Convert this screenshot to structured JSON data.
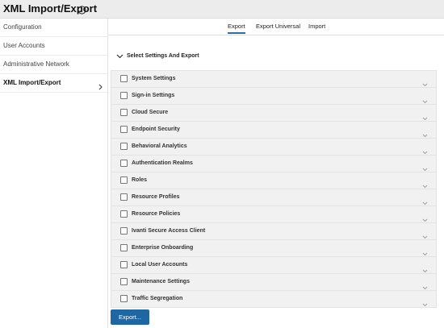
{
  "header": {
    "title": "XML Import/Export"
  },
  "sidebar": {
    "items": [
      {
        "label": "Configuration"
      },
      {
        "label": "User Accounts"
      },
      {
        "label": "Administrative Network"
      },
      {
        "label": "XML Import/Export"
      }
    ]
  },
  "tabs": [
    {
      "label": "Export"
    },
    {
      "label": "Export Universal"
    },
    {
      "label": "Import"
    }
  ],
  "section": {
    "label": "Select Settings And Export"
  },
  "settings": [
    {
      "label": "System Settings"
    },
    {
      "label": "Sign-in Settings"
    },
    {
      "label": "Cloud Secure"
    },
    {
      "label": "Endpoint Security"
    },
    {
      "label": "Behavioral Analytics"
    },
    {
      "label": "Authentication Realms"
    },
    {
      "label": "Roles"
    },
    {
      "label": "Resource Profiles"
    },
    {
      "label": "Resource Policies"
    },
    {
      "label": "Ivanti Secure Access Client"
    },
    {
      "label": "Enterprise Onboarding"
    },
    {
      "label": "Local User Accounts"
    },
    {
      "label": "Maintenance Settings"
    },
    {
      "label": "Traffic Segregation"
    }
  ],
  "actions": {
    "export_label": "Export..."
  },
  "colors": {
    "accent": "#1e67a3",
    "tab_underline": "#2e6ca4",
    "row_bg": "#f1f1f1"
  }
}
